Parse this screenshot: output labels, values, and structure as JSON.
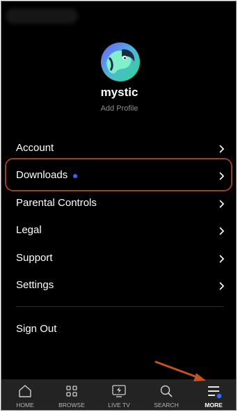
{
  "profile": {
    "name": "mystic",
    "add_profile_label": "Add Profile"
  },
  "menu": {
    "items": [
      {
        "label": "Account",
        "new_indicator": false
      },
      {
        "label": "Downloads",
        "new_indicator": true,
        "highlighted": true
      },
      {
        "label": "Parental Controls",
        "new_indicator": false
      },
      {
        "label": "Legal",
        "new_indicator": false
      },
      {
        "label": "Support",
        "new_indicator": false
      },
      {
        "label": "Settings",
        "new_indicator": false
      }
    ],
    "sign_out_label": "Sign Out"
  },
  "tabbar": {
    "tabs": [
      {
        "label": "HOME",
        "icon": "home-icon"
      },
      {
        "label": "BROWSE",
        "icon": "grid-icon"
      },
      {
        "label": "LIVE TV",
        "icon": "live-tv-icon"
      },
      {
        "label": "SEARCH",
        "icon": "search-icon"
      },
      {
        "label": "MORE",
        "icon": "menu-lines-icon",
        "active": true
      }
    ]
  },
  "colors": {
    "background": "#000000",
    "tabbar": "#232323",
    "accent_dot": "#2f6bff",
    "highlight_box": "#9a4020",
    "annotation_arrow": "#c4541f"
  }
}
